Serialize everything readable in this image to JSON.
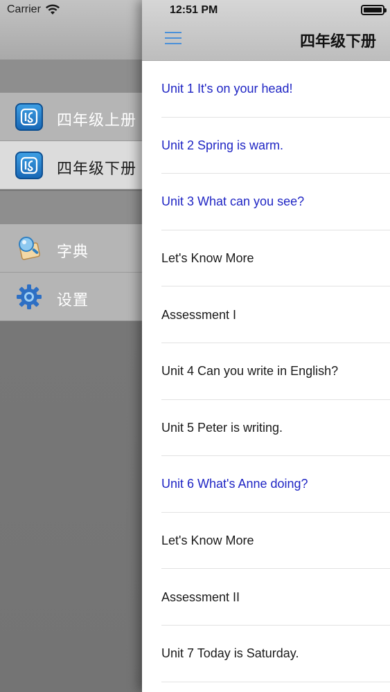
{
  "status": {
    "carrier": "Carrier",
    "time": "12:51 PM"
  },
  "sidebar": {
    "items": [
      {
        "label": "四年级上册",
        "icon": "book-app-icon",
        "selected": false
      },
      {
        "label": "四年级下册",
        "icon": "book-app-icon",
        "selected": true
      },
      {
        "label": "字典",
        "icon": "dictionary-icon",
        "selected": false
      },
      {
        "label": "设置",
        "icon": "gear-icon",
        "selected": false
      }
    ]
  },
  "navbar": {
    "title": "四年级下册",
    "menu_icon": "hamburger-menu-icon"
  },
  "colors": {
    "highlight": "#1f25c4",
    "menu_accent": "#4a90d9"
  },
  "lessons": [
    {
      "label": "Unit 1 It's on your head!",
      "highlighted": true
    },
    {
      "label": "Unit 2 Spring is warm.",
      "highlighted": true
    },
    {
      "label": "Unit 3 What can you see?",
      "highlighted": true
    },
    {
      "label": "Let's Know More",
      "highlighted": false
    },
    {
      "label": "Assessment I",
      "highlighted": false
    },
    {
      "label": "Unit 4 Can you write in English?",
      "highlighted": false
    },
    {
      "label": "Unit 5 Peter is writing.",
      "highlighted": false
    },
    {
      "label": "Unit 6 What's Anne doing?",
      "highlighted": true
    },
    {
      "label": "Let's Know More",
      "highlighted": false
    },
    {
      "label": "Assessment II",
      "highlighted": false
    },
    {
      "label": "Unit 7 Today is Saturday.",
      "highlighted": false
    }
  ]
}
